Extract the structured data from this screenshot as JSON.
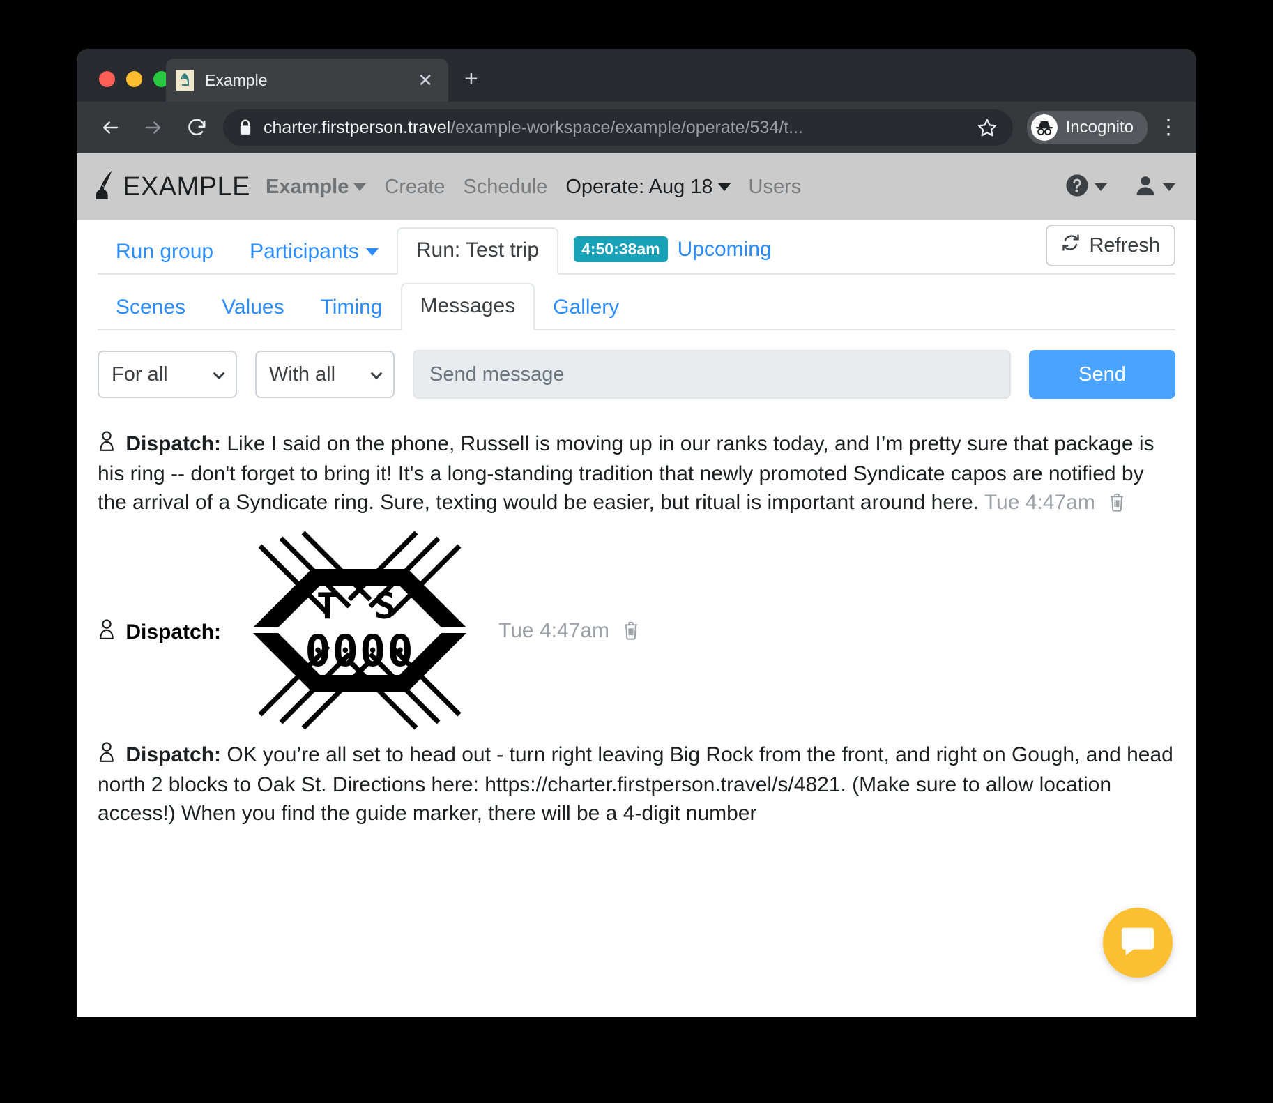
{
  "browser": {
    "tab": {
      "title": "Example",
      "favicon_icon": "chess-knight-icon",
      "close_icon": "close-icon"
    },
    "new_tab_label": "+",
    "back_icon": "arrow-left-icon",
    "forward_icon": "arrow-right-icon",
    "reload_icon": "reload-icon",
    "lock_icon": "lock-icon",
    "url_host": "charter.firstperson.travel",
    "url_path": "/example-workspace/example/operate/534/t...",
    "star_icon": "bookmark-star-icon",
    "incognito_label": "Incognito",
    "incognito_icon": "incognito-hat-icon",
    "menu_icon": "kebab-menu-icon"
  },
  "appnav": {
    "logo_icon": "quill-inkwell-icon",
    "brand": "EXAMPLE",
    "items": [
      {
        "label": "Example",
        "has_caret": true,
        "style": "strong"
      },
      {
        "label": "Create",
        "has_caret": false,
        "style": "muted"
      },
      {
        "label": "Schedule",
        "has_caret": false,
        "style": "muted"
      },
      {
        "label": "Operate: Aug 18",
        "has_caret": true,
        "style": "dark"
      },
      {
        "label": "Users",
        "has_caret": false,
        "style": "muted"
      }
    ],
    "help_icon": "help-circle-icon",
    "account_icon": "user-icon"
  },
  "tabs_primary": [
    {
      "label": "Run group",
      "active": false,
      "has_caret": false
    },
    {
      "label": "Participants",
      "active": false,
      "has_caret": true
    },
    {
      "label": "Run: Test trip",
      "active": true,
      "has_caret": false
    }
  ],
  "run_status": {
    "time_badge": "4:50:38am",
    "status": "Upcoming",
    "badge_color": "#17a2b8",
    "status_color": "#2a8cfd"
  },
  "refresh": {
    "label": "Refresh",
    "icon": "refresh-icon"
  },
  "tabs_secondary": [
    {
      "label": "Scenes",
      "active": false
    },
    {
      "label": "Values",
      "active": false
    },
    {
      "label": "Timing",
      "active": false
    },
    {
      "label": "Messages",
      "active": true
    },
    {
      "label": "Gallery",
      "active": false
    }
  ],
  "composer": {
    "audience_select": {
      "value": "For all",
      "options": [
        "For all"
      ]
    },
    "channel_select": {
      "value": "With all",
      "options": [
        "With all"
      ]
    },
    "message_input": {
      "value": "",
      "placeholder": "Send message"
    },
    "send_label": "Send"
  },
  "messages": [
    {
      "type": "text",
      "sender": "Dispatch:",
      "body": "Like I said on the phone, Russell is moving up in our ranks today, and I’m pretty sure that package is his ring -- don't forget to bring it! It's a long-standing tradition that newly promoted Syndicate capos are notified by the arrival of a Syndicate ring. Sure, texting would be easier, but ritual is important around here.",
      "time": "Tue 4:47am",
      "delete_icon": "trash-icon"
    },
    {
      "type": "image",
      "sender": "Dispatch:",
      "image_alt": "syndicate-ring-emblem",
      "emblem_initials": "T S",
      "emblem_number": "0000",
      "time": "Tue 4:47am",
      "delete_icon": "trash-icon"
    },
    {
      "type": "text",
      "sender": "Dispatch:",
      "body": "OK you’re all set to head out - turn right leaving Big Rock from the front, and right on Gough, and head north 2 blocks to Oak St. Directions here: https://charter.firstperson.travel/s/4821. (Make sure to allow location access!) When you find the guide marker, there will be a 4-digit number",
      "time": "",
      "delete_icon": "trash-icon"
    }
  ],
  "intercom": {
    "icon": "chat-bubble-icon",
    "color": "#fcbf32"
  }
}
